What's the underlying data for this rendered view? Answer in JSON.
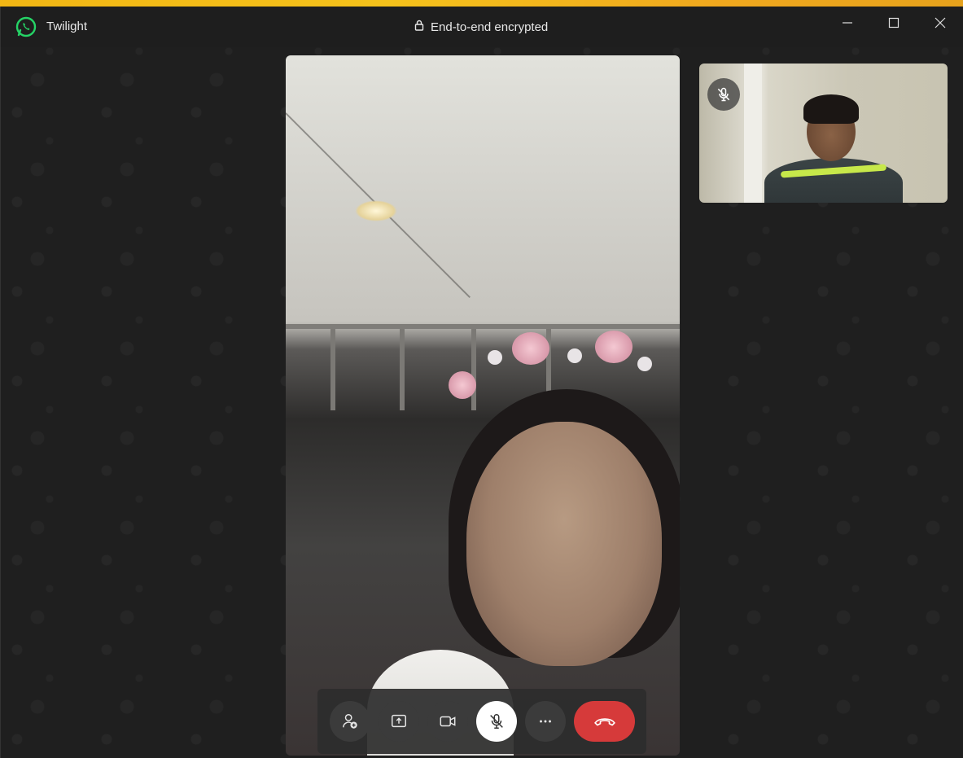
{
  "window": {
    "app_title": "Twilight",
    "encryption_label": "End-to-end encrypted"
  },
  "icons": {
    "app_logo": "whatsapp-icon",
    "lock": "lock-icon",
    "minimize": "minimize-icon",
    "maximize": "maximize-icon",
    "close": "close-icon",
    "participant_muted": "mic-off-icon"
  },
  "call_controls": [
    {
      "name": "add-participant-button",
      "icon": "add-person-icon"
    },
    {
      "name": "share-screen-button",
      "icon": "share-screen-icon"
    },
    {
      "name": "camera-button",
      "icon": "video-camera-icon"
    },
    {
      "name": "mute-button",
      "icon": "mic-off-icon",
      "active": true
    },
    {
      "name": "more-options-button",
      "icon": "more-horizontal-icon"
    },
    {
      "name": "end-call-button",
      "icon": "phone-hangup-icon"
    }
  ],
  "colors": {
    "end_call": "#d63a3a",
    "whatsapp_green": "#25d366",
    "background": "#1f1f1f"
  }
}
